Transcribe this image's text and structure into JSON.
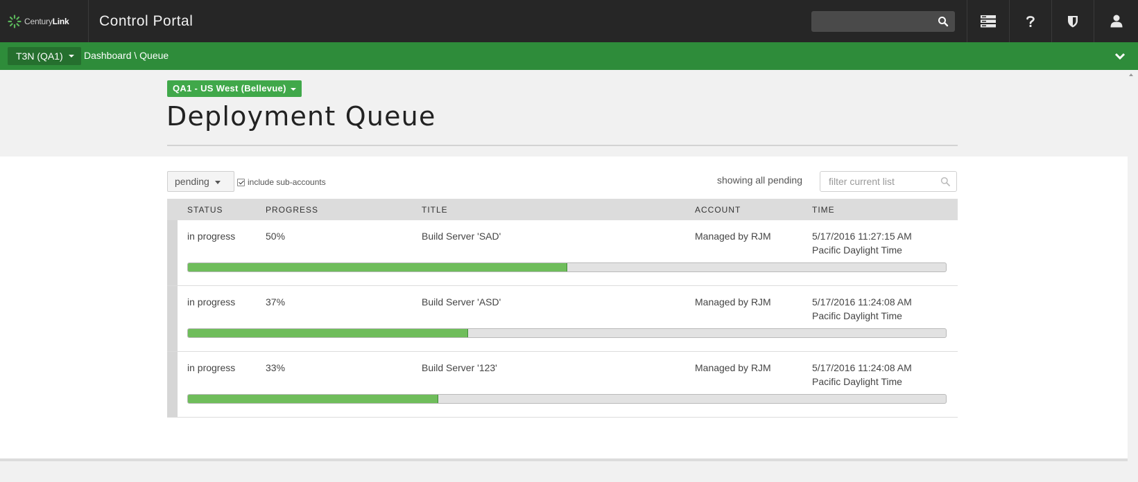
{
  "topbar": {
    "logo": {
      "brand_regular": "Century",
      "brand_bold": "Link"
    },
    "app_title": "Control Portal",
    "search": {
      "value": "",
      "placeholder": ""
    },
    "icons": [
      "search-icon",
      "server-stack-icon",
      "help-icon",
      "shield-icon",
      "user-icon"
    ]
  },
  "greenbar": {
    "account_label": "T3N (QA1)",
    "breadcrumb": "Dashboard \\ Queue",
    "colors": {
      "bar": "#2e8c3a",
      "account_button": "#256f2e"
    }
  },
  "header": {
    "region_label": "QA1 - US West (Bellevue)",
    "page_title": "Deployment Queue"
  },
  "toolbar": {
    "status_filter": "pending",
    "include_sub_accounts_label": "include sub-accounts",
    "include_sub_accounts_checked": true,
    "showing_text": "showing all pending",
    "filter": {
      "value": "",
      "placeholder": "filter current list"
    }
  },
  "table": {
    "columns": [
      "STATUS",
      "PROGRESS",
      "TITLE",
      "ACCOUNT",
      "TIME"
    ],
    "rows": [
      {
        "status": "in progress",
        "progress": "50%",
        "progress_value": 50,
        "title": "Build Server 'SAD'",
        "account": "Managed by RJM",
        "time": "5/17/2016 11:27:15 AM",
        "timezone": "Pacific Daylight Time"
      },
      {
        "status": "in progress",
        "progress": "37%",
        "progress_value": 37,
        "title": "Build Server 'ASD'",
        "account": "Managed by RJM",
        "time": "5/17/2016 11:24:08 AM",
        "timezone": "Pacific Daylight Time"
      },
      {
        "status": "in progress",
        "progress": "33%",
        "progress_value": 33,
        "title": "Build Server '123'",
        "account": "Managed by RJM",
        "time": "5/17/2016 11:24:08 AM",
        "timezone": "Pacific Daylight Time"
      }
    ]
  },
  "colors": {
    "progress_fill": "#6fbd5b",
    "region_button": "#40a84a",
    "topbar": "#262626"
  }
}
